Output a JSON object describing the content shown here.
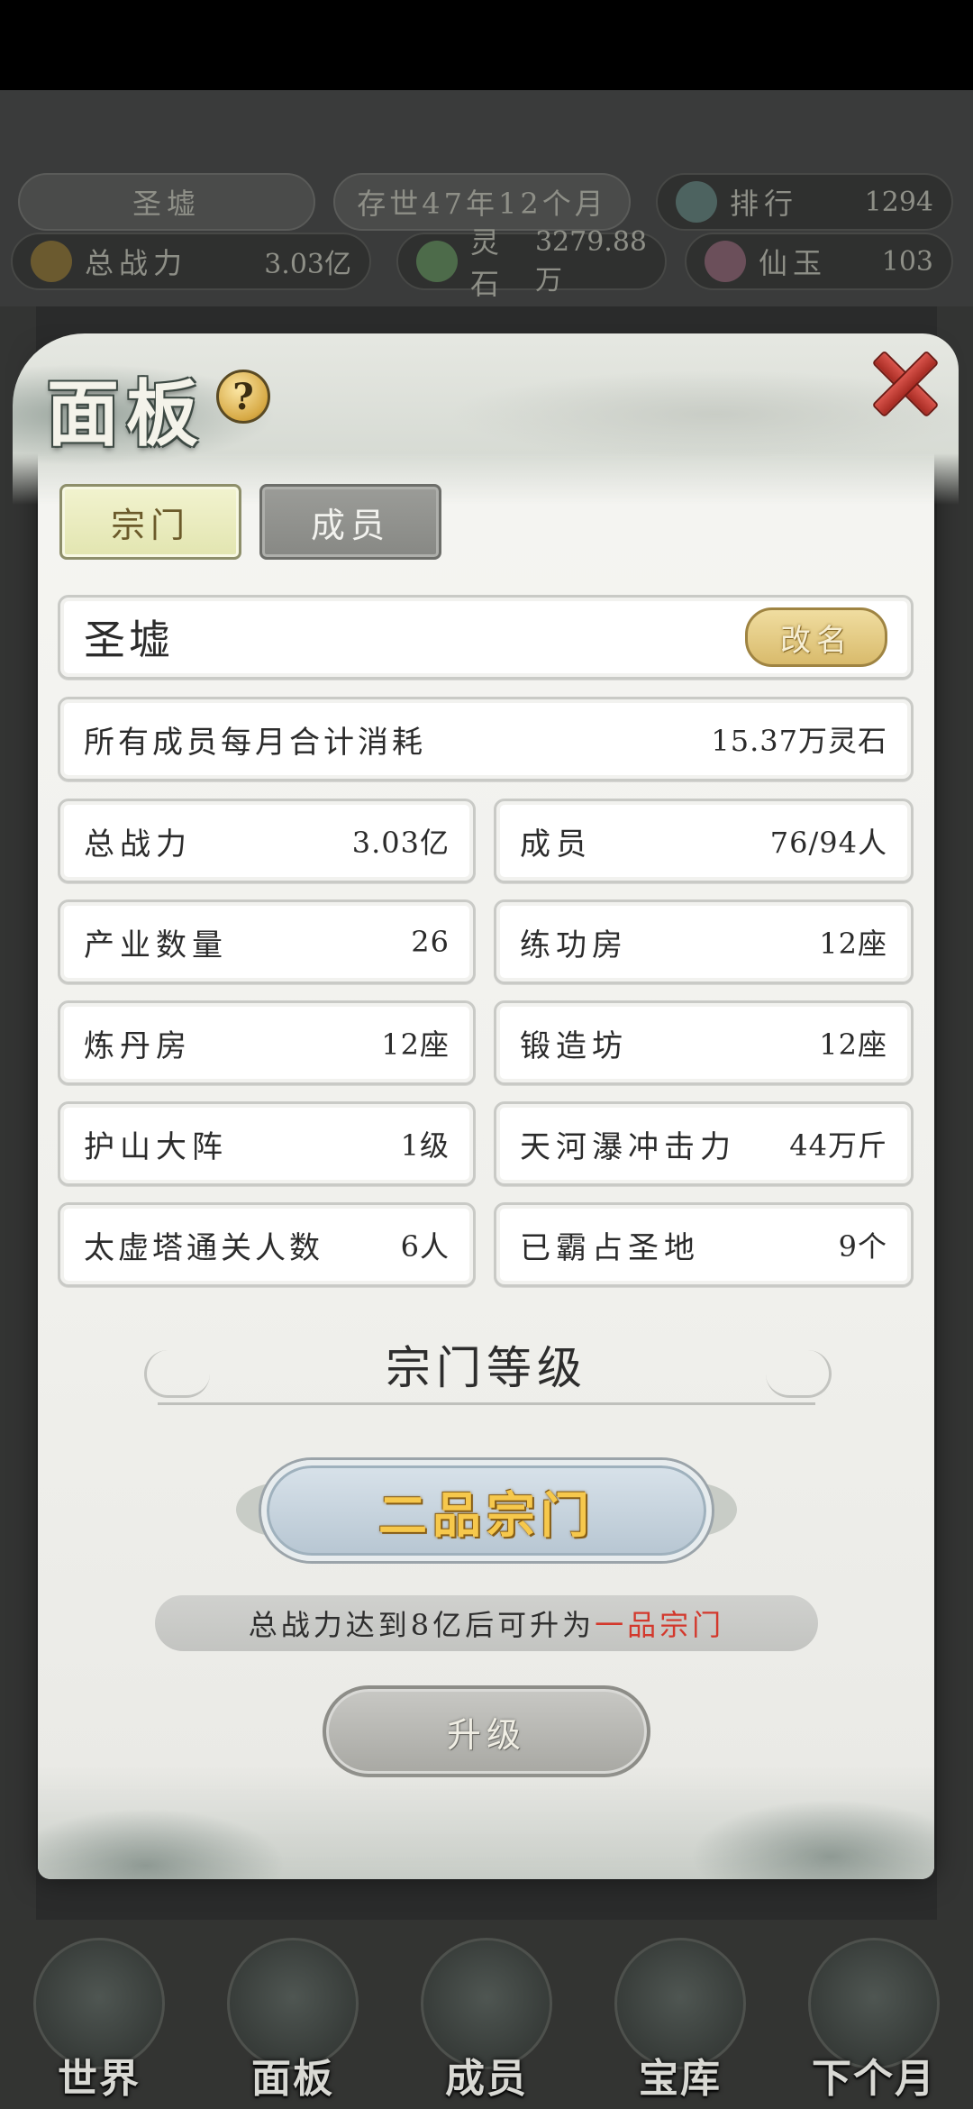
{
  "hud": {
    "sect_name": "圣墟",
    "age": "存世47年12个月",
    "rank_label": "排行",
    "rank_value": "1294",
    "power_label": "总战力",
    "power_value": "3.03亿",
    "spirit_stone_label": "灵石",
    "spirit_stone_value": "3279.88万",
    "immortal_jade_label": "仙玉",
    "immortal_jade_value": "103"
  },
  "panel": {
    "title": "面板",
    "help_glyph": "?",
    "tabs": [
      {
        "label": "宗门",
        "active": true
      },
      {
        "label": "成员",
        "active": false
      }
    ],
    "sect_name": "圣墟",
    "rename_label": "改名",
    "monthly_cost_label": "所有成员每月合计消耗",
    "monthly_cost_value": "15.37万灵石",
    "stats": [
      {
        "label": "总战力",
        "value": "3.03亿"
      },
      {
        "label": "成员",
        "value": "76/94人"
      },
      {
        "label": "产业数量",
        "value": "26"
      },
      {
        "label": "练功房",
        "value": "12座"
      },
      {
        "label": "炼丹房",
        "value": "12座"
      },
      {
        "label": "锻造坊",
        "value": "12座"
      },
      {
        "label": "护山大阵",
        "value": "1级"
      },
      {
        "label": "天河瀑冲击力",
        "value": "44万斤"
      },
      {
        "label": "太虚塔通关人数",
        "value": "6人"
      },
      {
        "label": "已霸占圣地",
        "value": "9个"
      }
    ],
    "section_title": "宗门等级",
    "grade": "二品宗门",
    "hint_prefix": "总战力达到8亿后可升为",
    "hint_target": "一品宗门",
    "upgrade_label": "升级"
  },
  "bottom_nav": [
    {
      "label": "世界"
    },
    {
      "label": "面板"
    },
    {
      "label": "成员"
    },
    {
      "label": "宝库"
    },
    {
      "label": "下个月"
    }
  ],
  "colors": {
    "hint_highlight": "#d3382c",
    "grade_text": "#f6c84c",
    "close_red": "#c0392b"
  }
}
